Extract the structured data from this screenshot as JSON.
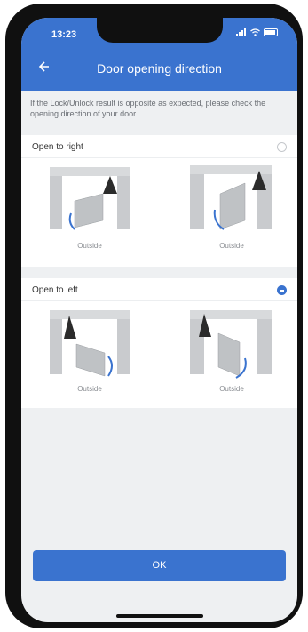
{
  "status_bar": {
    "time": "13:23"
  },
  "header": {
    "title": "Door opening direction",
    "back_icon": "arrow-left-icon"
  },
  "hint": "If the Lock/Unlock result is opposite as expected, please check the opening direction of your door.",
  "options": [
    {
      "label": "Open to right",
      "selected": false,
      "captions": [
        "Outside",
        "Outside"
      ]
    },
    {
      "label": "Open to left",
      "selected": true,
      "captions": [
        "Outside",
        "Outside"
      ]
    }
  ],
  "ok_button": {
    "label": "OK"
  },
  "colors": {
    "accent": "#3a73cf",
    "background": "#eef0f2"
  }
}
